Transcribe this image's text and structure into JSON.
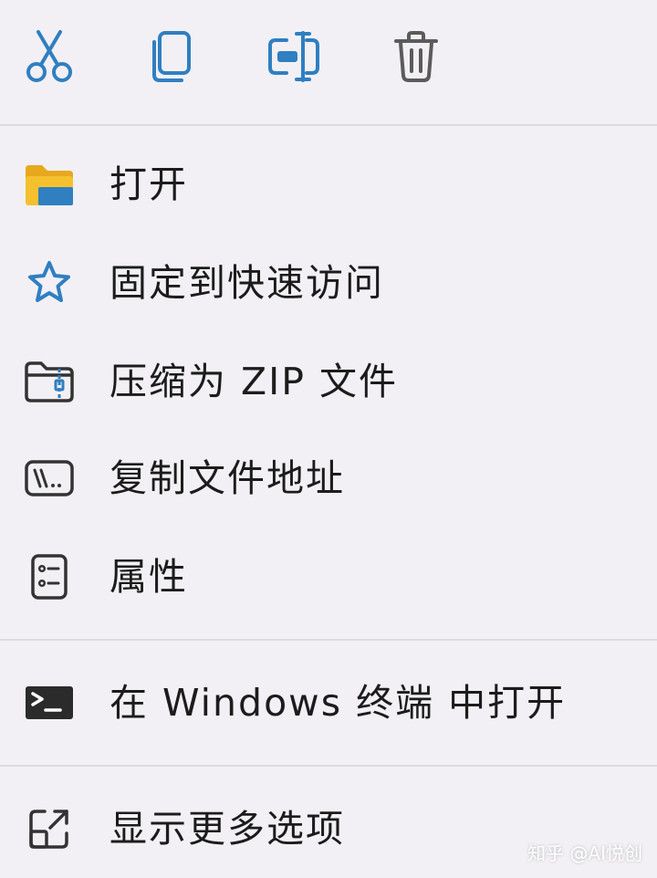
{
  "colors": {
    "background": "#f2f0f4",
    "accent": "#2f7fc1",
    "folder_yellow": "#f5c02e",
    "text": "#1c1c1c",
    "separator": "#dedbe0"
  },
  "toolbar": {
    "buttons": [
      {
        "icon": "scissors-icon"
      },
      {
        "icon": "copy-icon"
      },
      {
        "icon": "rename-icon"
      },
      {
        "icon": "trash-icon"
      }
    ]
  },
  "menu": {
    "items": [
      {
        "label": "打开",
        "icon": "folder-icon"
      },
      {
        "label": "固定到快速访问",
        "icon": "star-icon"
      },
      {
        "label": "压缩为 ZIP 文件",
        "icon": "zip-folder-icon"
      },
      {
        "label": "复制文件地址",
        "icon": "copy-path-icon"
      },
      {
        "label": "属性",
        "icon": "properties-icon"
      },
      {
        "label": "在 Windows 终端 中打开",
        "icon": "terminal-icon"
      },
      {
        "label": "显示更多选项",
        "icon": "more-options-icon"
      }
    ]
  },
  "watermark": {
    "text": "知乎 @AI悦创"
  }
}
